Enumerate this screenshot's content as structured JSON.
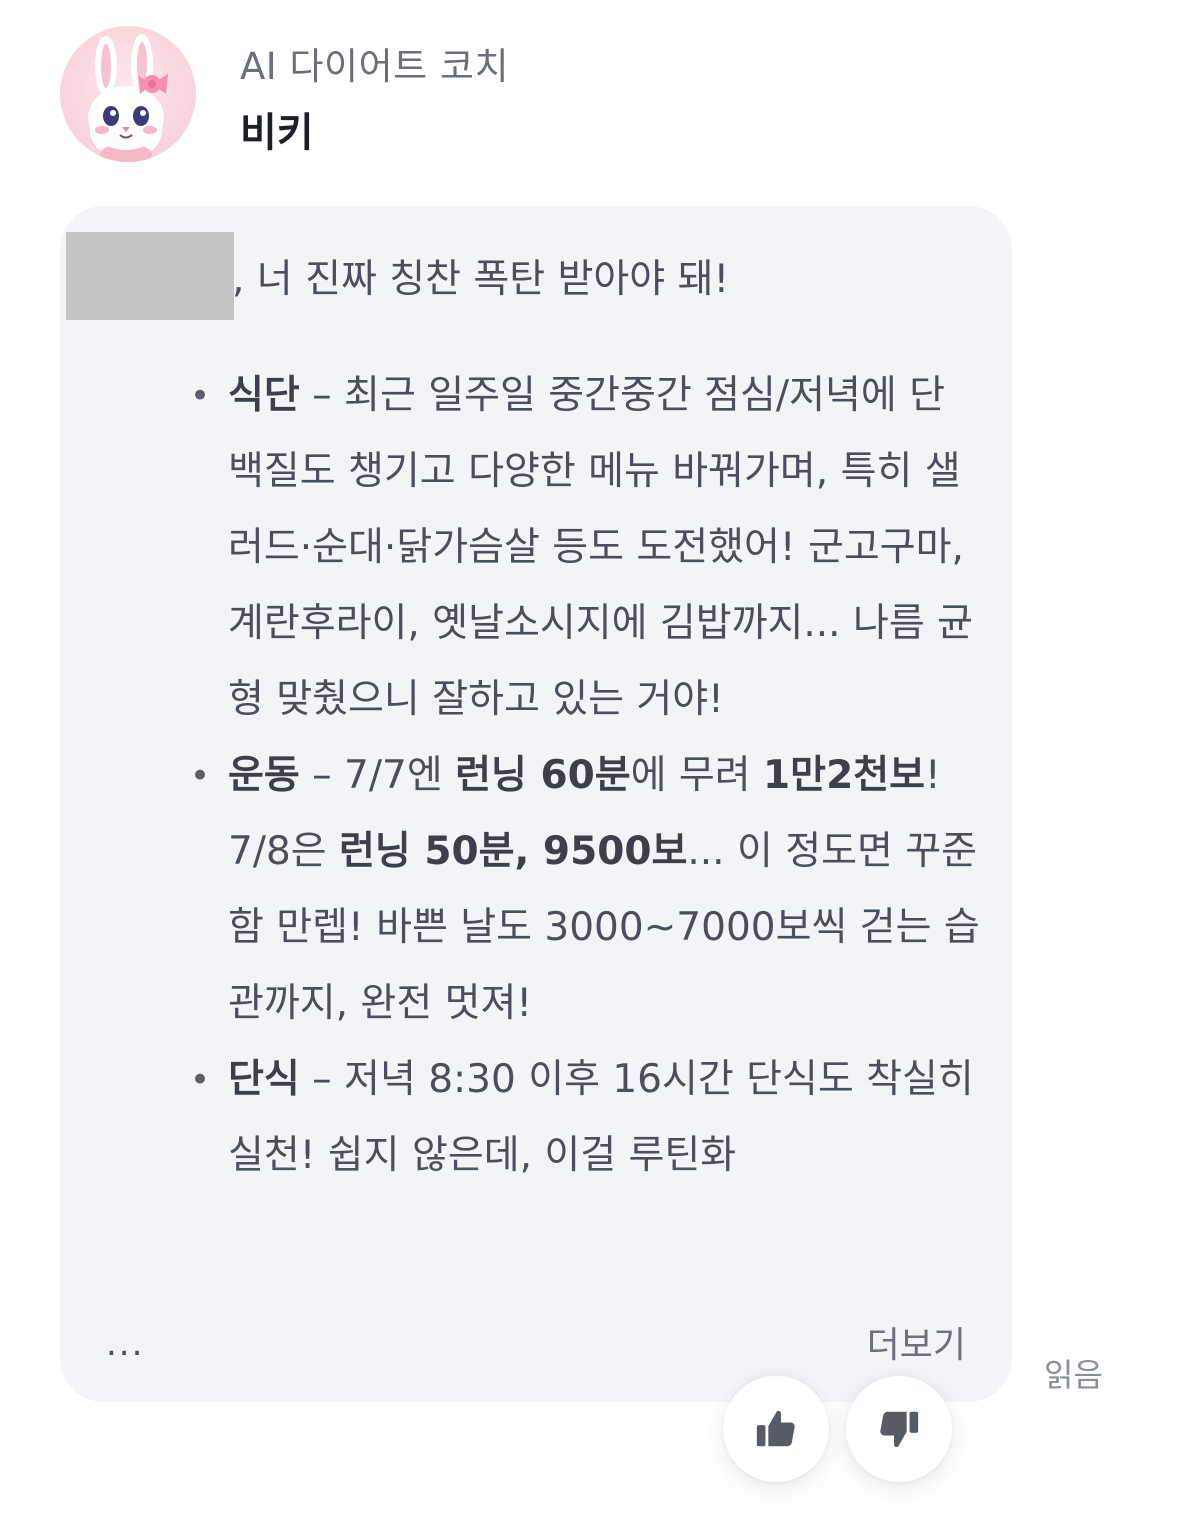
{
  "sender": {
    "role": "AI 다이어트 코치",
    "name": "비키"
  },
  "message": {
    "greeting": ", 너 진짜 칭찬 폭탄 받아야 돼!",
    "items": [
      {
        "title": "식단",
        "segments": [
          {
            "text": "식단",
            "bold": true
          },
          {
            "text": " – 최근 일주일 중간중간 점심/저녁에 단백질도 챙기고 다양한 메뉴 바꿔가며, 특히 샐러드·순대·닭가슴살 등도 도전했어! 군고구마, 계란후라이, 옛날소시지에 김밥까지... 나름 균형 맞췄으니 잘하고 있는 거야!",
            "bold": false
          }
        ]
      },
      {
        "title": "운동",
        "segments": [
          {
            "text": "운동",
            "bold": true
          },
          {
            "text": " – 7/7엔 ",
            "bold": false
          },
          {
            "text": "런닝 60분",
            "bold": true
          },
          {
            "text": "에 무려 ",
            "bold": false
          },
          {
            "text": "1만2천보",
            "bold": true
          },
          {
            "text": "! 7/8은 ",
            "bold": false
          },
          {
            "text": "런닝 50분, 9500보",
            "bold": true
          },
          {
            "text": "... 이 정도면 꾸준함 만렙! 바쁜 날도 3000~7000보씩 걷는 습관까지, 완전 멋져!",
            "bold": false
          }
        ]
      },
      {
        "title": "단식",
        "segments": [
          {
            "text": "단식",
            "bold": true
          },
          {
            "text": " – 저녁 8:30 이후 16시간 단식도 착실히 실천! 쉽지 않은데, 이걸 루틴화",
            "bold": false
          }
        ]
      }
    ],
    "more_label": "더보기",
    "overflow_label": "..."
  },
  "status": {
    "read_label": "읽음"
  },
  "feedback": {
    "like_icon": "thumbs-up-icon",
    "dislike_icon": "thumbs-down-icon"
  },
  "colors": {
    "bubble_bg": "#f3f4f8",
    "text": "#4a4f5c",
    "redaction": "#c4c4c4"
  }
}
